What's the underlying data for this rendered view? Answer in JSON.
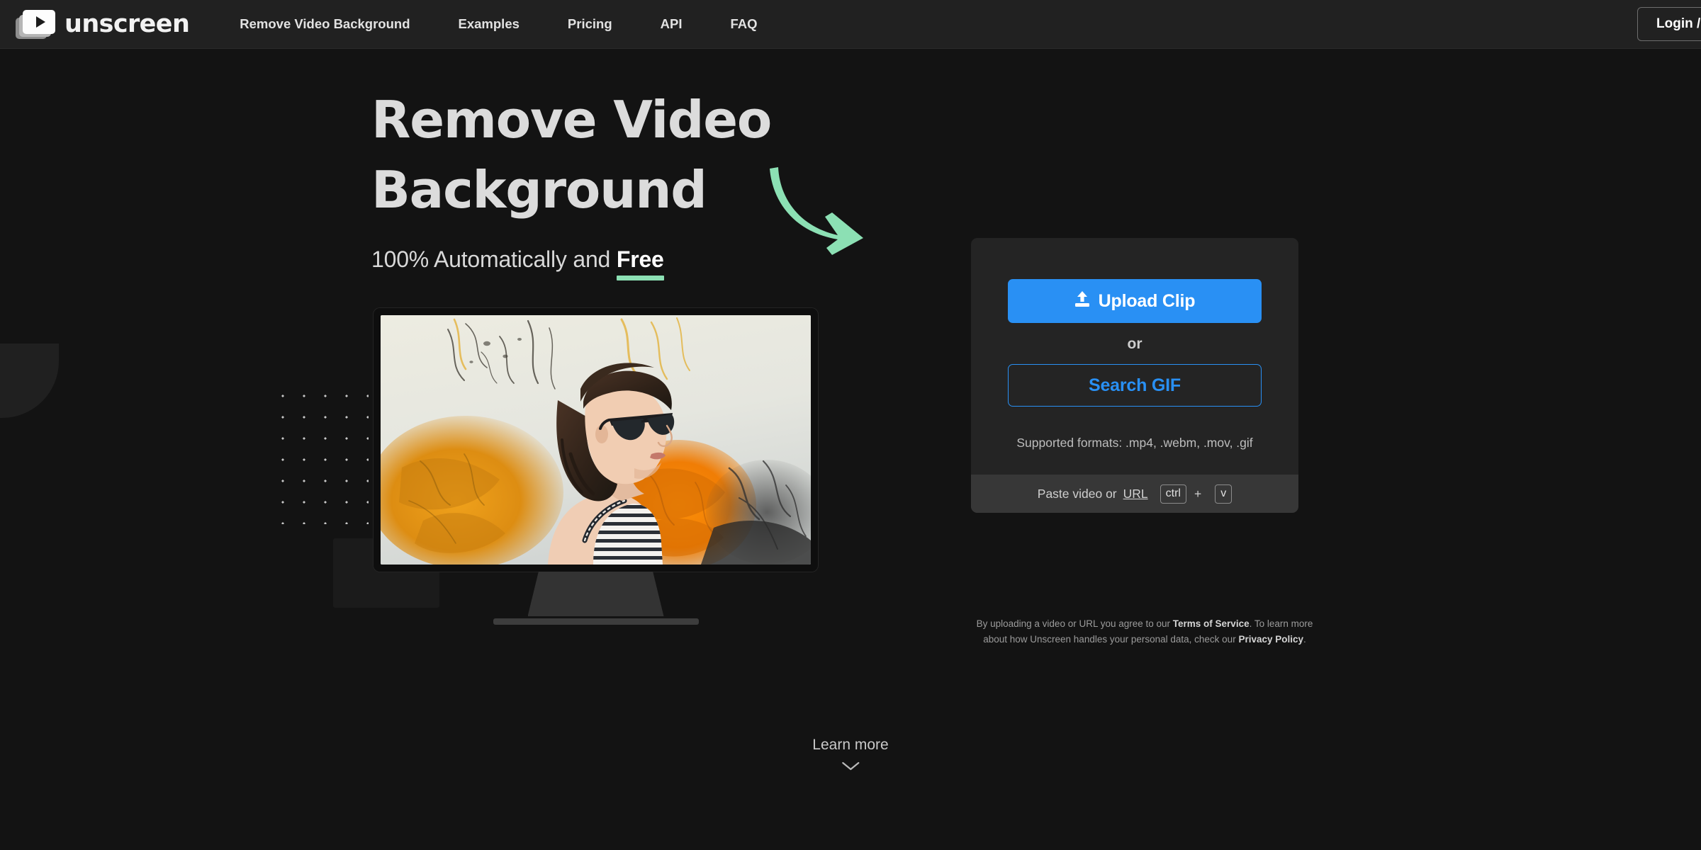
{
  "header": {
    "logo_text": "unscreen",
    "logo_icon": "video-stack-play-icon",
    "nav": [
      {
        "label": "Remove Video Background"
      },
      {
        "label": "Examples"
      },
      {
        "label": "Pricing"
      },
      {
        "label": "API"
      },
      {
        "label": "FAQ"
      }
    ],
    "login_label": "Login / Sign Up"
  },
  "hero": {
    "title_line1": "Remove Video",
    "title_line2": "Background",
    "subtitle_prefix": "100% Automatically and ",
    "subtitle_highlight": "Free",
    "arrow_icon": "curved-arrow-down-right-icon",
    "accent_color": "#8ce0b4"
  },
  "preview": {
    "monitor_icon": "desktop-monitor",
    "video_alt": "woman-with-sunglasses-ink-background"
  },
  "panel": {
    "upload_label": "Upload Clip",
    "upload_icon": "upload-icon",
    "or_label": "or",
    "search_gif_label": "Search GIF",
    "formats_label": "Supported formats: .mp4, .webm, .mov, .gif",
    "paste_label": "Paste video or",
    "paste_url_label": "URL",
    "key_ctrl": "ctrl",
    "key_plus": "+",
    "key_v": "v",
    "primary_color": "#2990f4"
  },
  "legal": {
    "part1": "By uploading a video or URL you agree to our ",
    "terms": "Terms of Service",
    "part2": ". To learn more about how Unscreen handles your personal data, check our ",
    "privacy": "Privacy Policy",
    "part3": "."
  },
  "footer": {
    "learn_more_label": "Learn more",
    "chevron_icon": "chevron-down-icon"
  }
}
